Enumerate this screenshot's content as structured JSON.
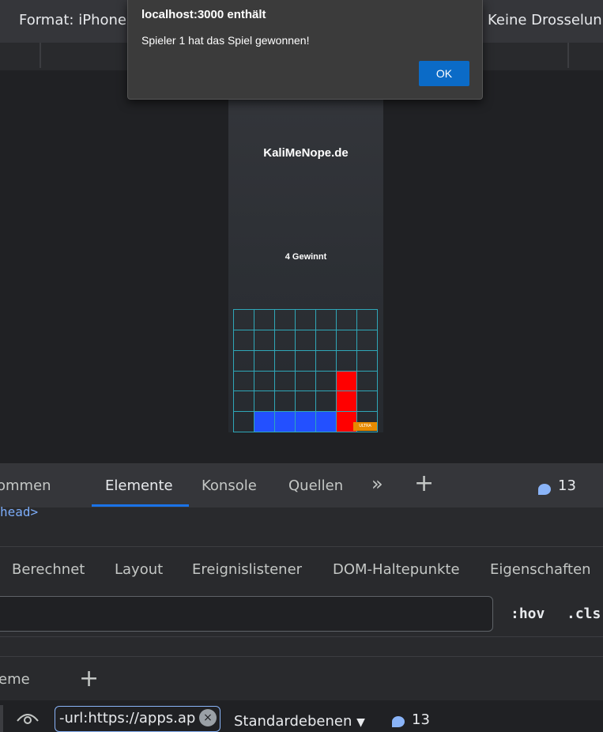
{
  "toolbar": {
    "format_label": "Format: iPhone",
    "throttle_label": "Keine Drosselun"
  },
  "device_page": {
    "site_title": "KaliMeNope.de",
    "game_title": "4 Gewinnt",
    "board": {
      "rows": 6,
      "cols": 7,
      "cells": [
        [
          0,
          0,
          0,
          0,
          0,
          0,
          0
        ],
        [
          0,
          0,
          0,
          0,
          0,
          0,
          0
        ],
        [
          0,
          0,
          0,
          0,
          0,
          0,
          0
        ],
        [
          0,
          0,
          0,
          0,
          0,
          1,
          0
        ],
        [
          0,
          0,
          0,
          0,
          0,
          1,
          0
        ],
        [
          0,
          2,
          2,
          2,
          2,
          1,
          0
        ]
      ],
      "colors": {
        "player1": "#ff0000",
        "player2": "#2350ff"
      }
    },
    "badge_text": "ULTRA"
  },
  "dialog": {
    "title": "localhost:3000 enthält",
    "message": "Spieler 1 hat das Spiel gewonnen!",
    "ok_label": "OK"
  },
  "devtools": {
    "tabs": [
      {
        "label": "ommen"
      },
      {
        "label": "Elemente",
        "active": true
      },
      {
        "label": "Konsole"
      },
      {
        "label": "Quellen"
      }
    ],
    "message_count": "13",
    "dom_snippet": "head>",
    "sub_tabs": [
      "Berechnet",
      "Layout",
      "Ereignislistener",
      "DOM-Haltepunkte",
      "Eigenschaften"
    ],
    "hov_label": ":hov",
    "cls_label": ".cls",
    "layer_tab": "eme",
    "url_filter_value": "-url:https://apps.ap",
    "layer_select": "Standardebenen",
    "bottom_count": "13",
    "accent_color": "#1a73e8"
  }
}
